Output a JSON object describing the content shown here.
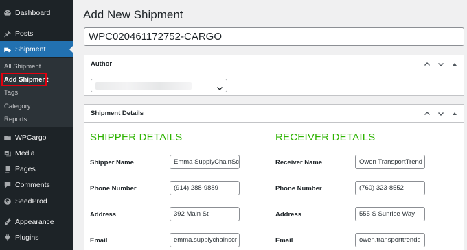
{
  "sidebar": {
    "items": [
      {
        "label": "Dashboard",
        "icon": "dashboard-icon"
      },
      {
        "label": "Posts",
        "icon": "pin-icon"
      },
      {
        "label": "Shipment",
        "icon": "truck-icon"
      },
      {
        "label": "WPCargo",
        "icon": "folder-icon"
      },
      {
        "label": "Media",
        "icon": "media-icon"
      },
      {
        "label": "Pages",
        "icon": "pages-icon"
      },
      {
        "label": "Comments",
        "icon": "comment-icon"
      },
      {
        "label": "SeedProd",
        "icon": "seedprod-icon"
      },
      {
        "label": "Appearance",
        "icon": "brush-icon"
      },
      {
        "label": "Plugins",
        "icon": "plug-icon"
      }
    ],
    "submenu": [
      "All Shipment",
      "Add Shipment",
      "Tags",
      "Category",
      "Reports"
    ],
    "active_color": "#2271b1",
    "highlight_color": "#e3000f"
  },
  "main": {
    "page_title": "Add New Shipment",
    "shipment_title_value": "WPC020461172752-CARGO",
    "author_box": {
      "title": "Author"
    },
    "details_box": {
      "title": "Shipment Details"
    },
    "shipper": {
      "heading": "SHIPPER DETAILS",
      "fields": [
        {
          "label": "Shipper Name",
          "value": "Emma SupplyChainSc"
        },
        {
          "label": "Phone Number",
          "value": "(914) 288-9889"
        },
        {
          "label": "Address",
          "value": "392 Main St"
        },
        {
          "label": "Email",
          "value": "emma.supplychainscr"
        }
      ]
    },
    "receiver": {
      "heading": "RECEIVER DETAILS",
      "fields": [
        {
          "label": "Receiver Name",
          "value": "Owen TransportTrend"
        },
        {
          "label": "Phone Number",
          "value": "(760) 323-8552"
        },
        {
          "label": "Address",
          "value": "555 S Sunrise Way"
        },
        {
          "label": "Email",
          "value": "owen.transporttrends"
        }
      ]
    },
    "heading_color": "#2db300"
  }
}
